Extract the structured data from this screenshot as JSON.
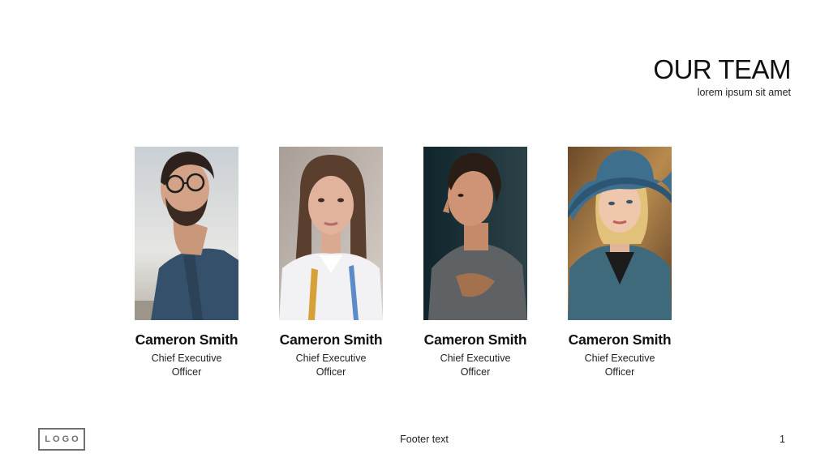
{
  "header": {
    "title": "OUR TEAM",
    "subtitle": "lorem ipsum sit amet"
  },
  "team": [
    {
      "name": "Cameron Smith",
      "role": "Chief Executive Officer",
      "photo": "portrait-bearded-man-glasses"
    },
    {
      "name": "Cameron Smith",
      "role": "Chief Executive Officer",
      "photo": "portrait-young-woman"
    },
    {
      "name": "Cameron Smith",
      "role": "Chief Executive Officer",
      "photo": "portrait-man-profile"
    },
    {
      "name": "Cameron Smith",
      "role": "Chief Executive Officer",
      "photo": "portrait-woman-blue-hat"
    }
  ],
  "footer": {
    "logo": "LOGO",
    "text": "Footer text",
    "page_number": "1"
  }
}
